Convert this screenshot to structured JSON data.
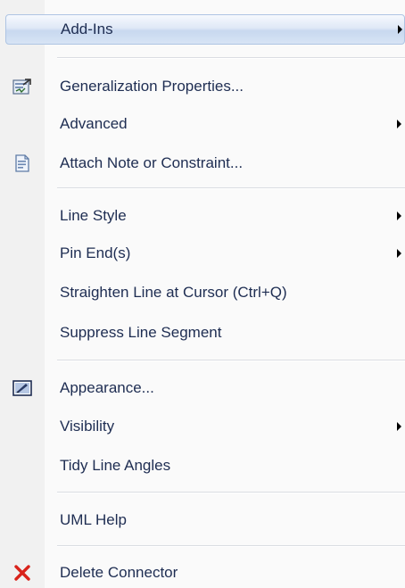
{
  "menu": {
    "items": [
      {
        "label": "Add-Ins",
        "submenu": true
      },
      {
        "label": "Generalization Properties...",
        "icon": "properties-icon"
      },
      {
        "label": "Advanced",
        "submenu": true
      },
      {
        "label": "Attach Note or Constraint...",
        "icon": "note-icon"
      },
      {
        "label": "Line Style",
        "submenu": true
      },
      {
        "label": "Pin End(s)",
        "submenu": true
      },
      {
        "label": "Straighten Line at Cursor (Ctrl+Q)"
      },
      {
        "label": "Suppress Line Segment"
      },
      {
        "label": "Appearance...",
        "icon": "appearance-icon"
      },
      {
        "label": "Visibility",
        "submenu": true
      },
      {
        "label": "Tidy Line Angles"
      },
      {
        "label": "UML Help"
      },
      {
        "label": "Delete Connector",
        "icon": "delete-icon"
      }
    ]
  },
  "colors": {
    "label_text": "#1e2d52",
    "highlight_border": "#aec4e3",
    "delete_red": "#d9231b"
  }
}
